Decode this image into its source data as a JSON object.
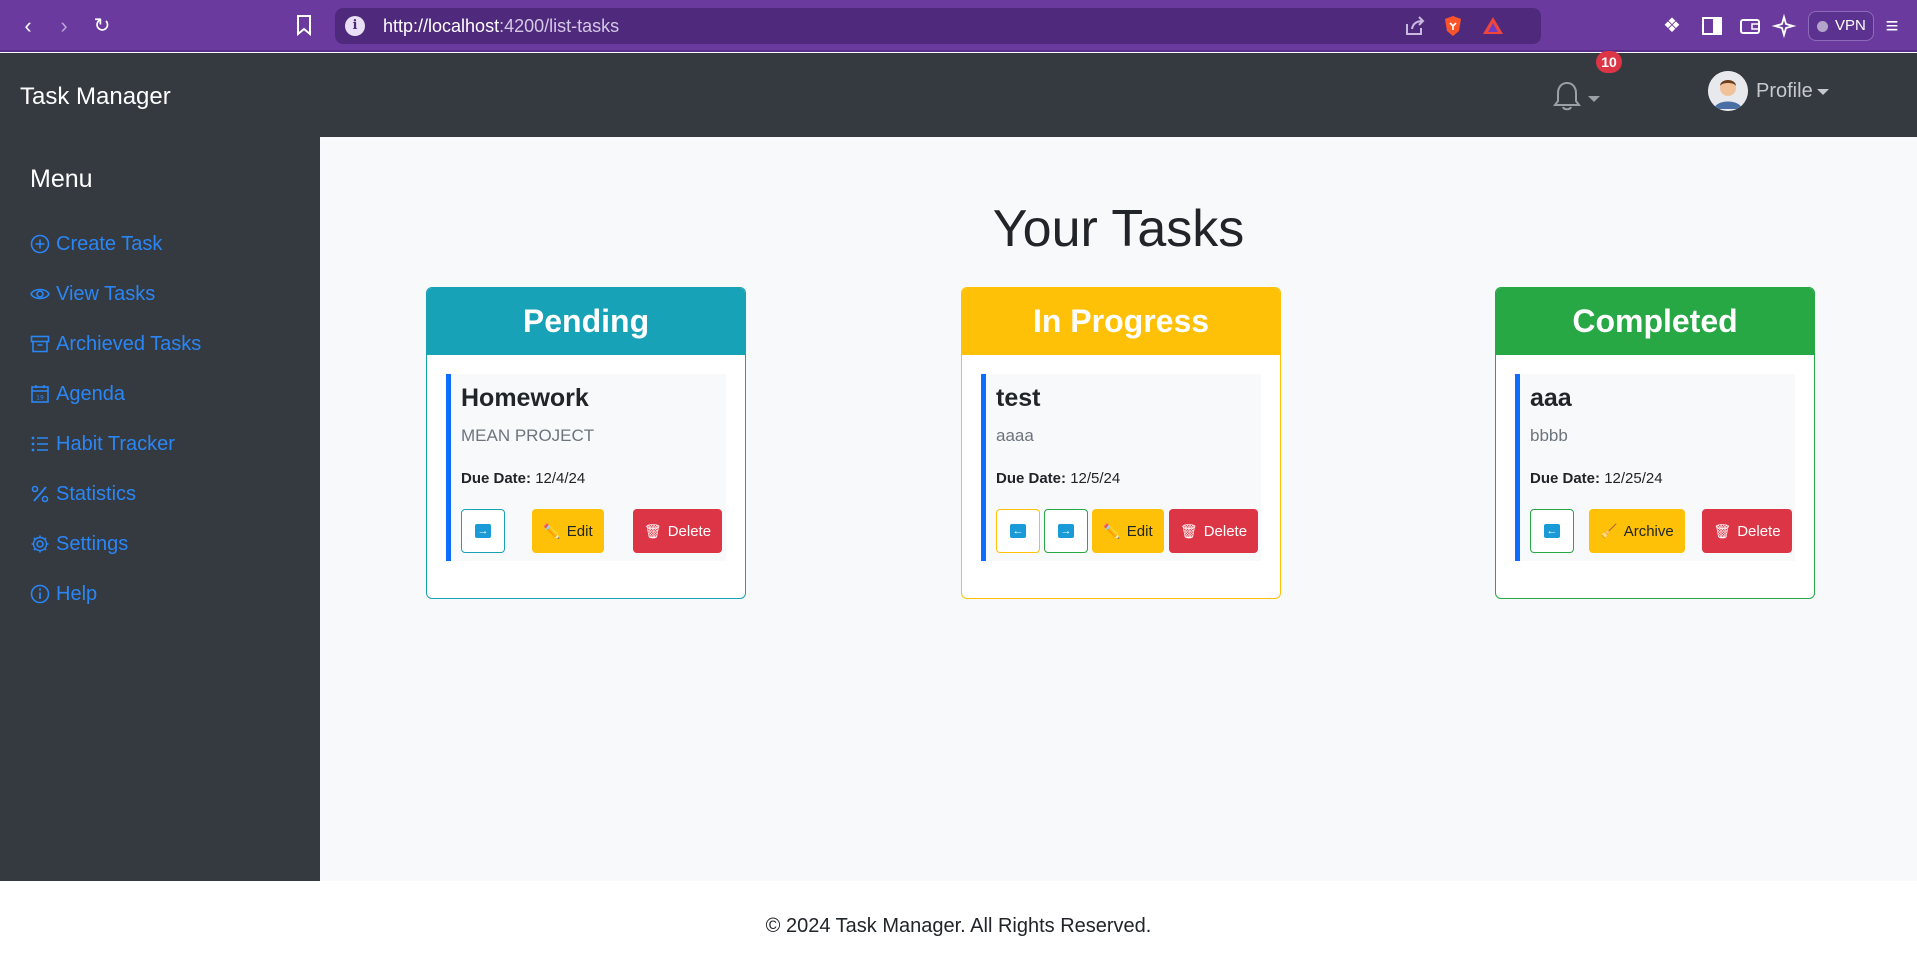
{
  "browser": {
    "url_host": "http://localhost",
    "url_path": ":4200/list-tasks",
    "vpn_label": "VPN"
  },
  "navbar": {
    "brand": "Task Manager",
    "notification_count": "10",
    "profile_label": "Profile"
  },
  "sidebar": {
    "title": "Menu",
    "items": [
      {
        "label": "Create Task",
        "icon": "plus-circle-icon"
      },
      {
        "label": "View Tasks",
        "icon": "eye-icon"
      },
      {
        "label": "Archieved Tasks",
        "icon": "archive-icon"
      },
      {
        "label": "Agenda",
        "icon": "calendar-icon"
      },
      {
        "label": "Habit Tracker",
        "icon": "list-icon"
      },
      {
        "label": "Statistics",
        "icon": "percent-icon"
      },
      {
        "label": "Settings",
        "icon": "gear-icon"
      },
      {
        "label": "Help",
        "icon": "info-icon"
      }
    ]
  },
  "main": {
    "title": "Your Tasks",
    "columns": [
      {
        "title": "Pending",
        "color": "#17a2b8",
        "task": {
          "title": "Homework",
          "description": "MEAN PROJECT",
          "due_label": "Due Date:",
          "due": "12/4/24"
        },
        "buttons": {
          "edit": "Edit",
          "delete": "Delete"
        }
      },
      {
        "title": "In Progress",
        "color": "#ffc107",
        "task": {
          "title": "test",
          "description": "aaaa",
          "due_label": "Due Date:",
          "due": "12/5/24"
        },
        "buttons": {
          "edit": "Edit",
          "delete": "Delete"
        }
      },
      {
        "title": "Completed",
        "color": "#28a745",
        "task": {
          "title": "aaa",
          "description": "bbbb",
          "due_label": "Due Date:",
          "due": "12/25/24"
        },
        "buttons": {
          "archive": "Archive",
          "delete": "Delete"
        }
      }
    ]
  },
  "footer": {
    "text": "© 2024 Task Manager. All Rights Reserved."
  }
}
